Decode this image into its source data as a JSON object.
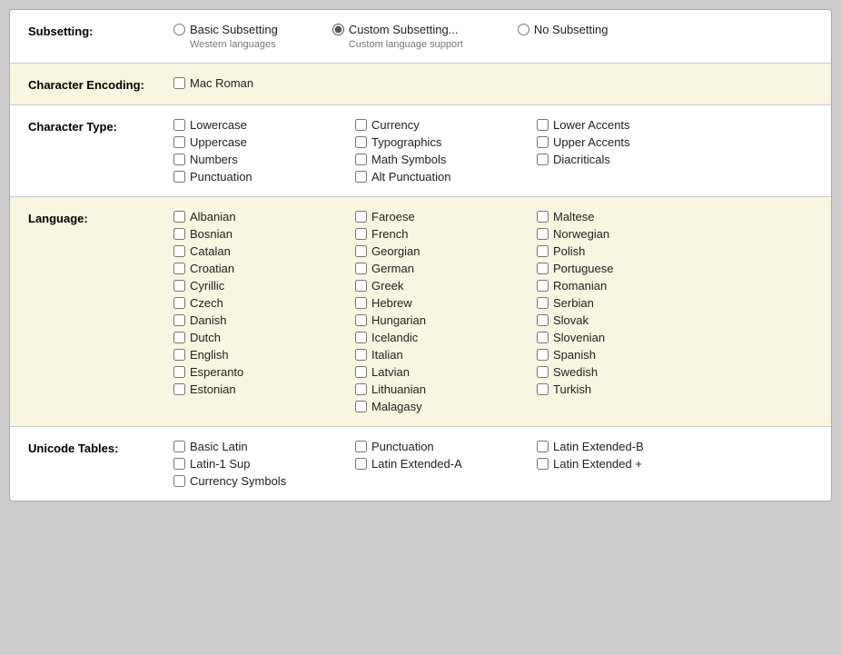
{
  "subsetting": {
    "label": "Subsetting:",
    "options": [
      {
        "id": "basic",
        "label": "Basic Subsetting",
        "sublabel": "Western languages",
        "checked": false
      },
      {
        "id": "custom",
        "label": "Custom Subsetting...",
        "sublabel": "Custom language support",
        "checked": true
      },
      {
        "id": "none",
        "label": "No Subsetting",
        "sublabel": "",
        "checked": false
      }
    ]
  },
  "encoding": {
    "label": "Character Encoding:",
    "value": "Mac Roman"
  },
  "chartype": {
    "label": "Character Type:",
    "col1": [
      "Lowercase",
      "Uppercase",
      "Numbers",
      "Punctuation"
    ],
    "col2": [
      "Currency",
      "Typographics",
      "Math Symbols",
      "Alt Punctuation"
    ],
    "col3": [
      "Lower Accents",
      "Upper Accents",
      "Diacriticals"
    ]
  },
  "language": {
    "label": "Language:",
    "col1": [
      "Albanian",
      "Bosnian",
      "Catalan",
      "Croatian",
      "Cyrillic",
      "Czech",
      "Danish",
      "Dutch",
      "English",
      "Esperanto",
      "Estonian"
    ],
    "col2": [
      "Faroese",
      "French",
      "Georgian",
      "German",
      "Greek",
      "Hebrew",
      "Hungarian",
      "Icelandic",
      "Italian",
      "Latvian",
      "Lithuanian",
      "Malagasy"
    ],
    "col3": [
      "Maltese",
      "Norwegian",
      "Polish",
      "Portuguese",
      "Romanian",
      "Serbian",
      "Slovak",
      "Slovenian",
      "Spanish",
      "Swedish",
      "Turkish"
    ]
  },
  "unicode": {
    "label": "Unicode Tables:",
    "col1": [
      "Basic Latin",
      "Latin-1 Sup",
      "Currency Symbols"
    ],
    "col2": [
      "Punctuation",
      "Latin Extended-A"
    ],
    "col3": [
      "Latin Extended-B",
      "Latin Extended +"
    ]
  }
}
